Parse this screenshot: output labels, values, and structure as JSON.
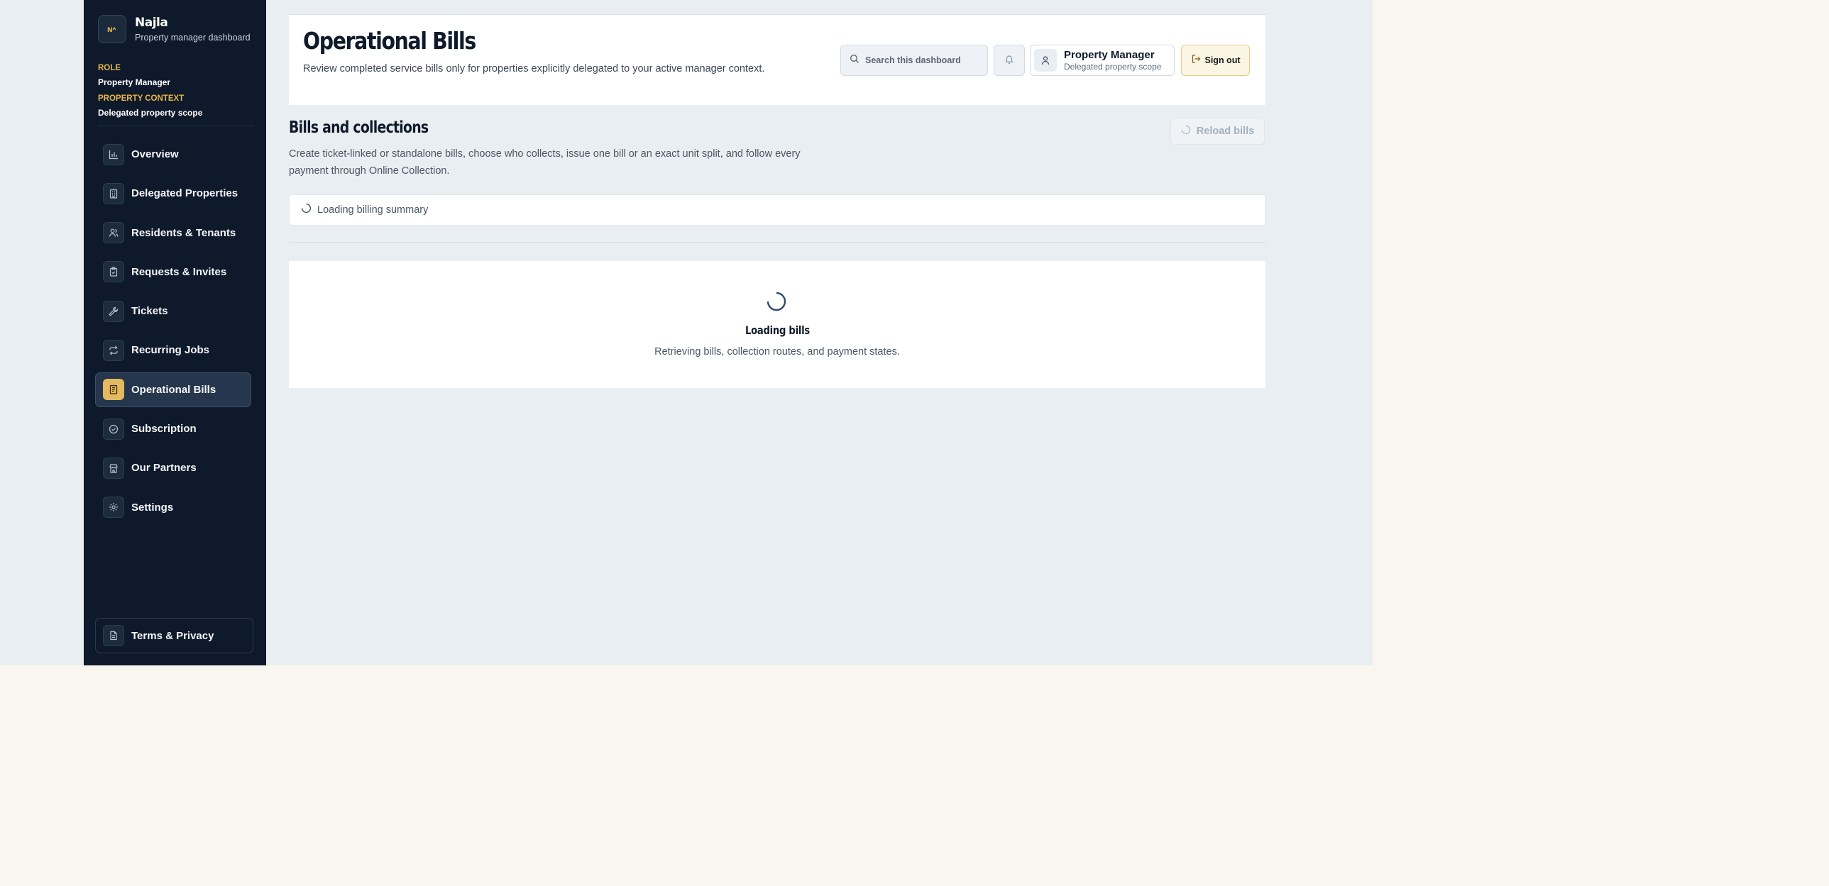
{
  "brand": {
    "logo_text": "Nਕ",
    "name": "Najla",
    "subtitle": "Property manager dashboard"
  },
  "meta": {
    "role_label": "ROLE",
    "role_value": "Property Manager",
    "context_label": "PROPERTY CONTEXT",
    "context_value": "Delegated property scope"
  },
  "nav": [
    {
      "label": "Overview",
      "icon": "bar-chart-icon"
    },
    {
      "label": "Delegated Properties",
      "icon": "building-icon"
    },
    {
      "label": "Residents & Tenants",
      "icon": "users-icon"
    },
    {
      "label": "Requests & Invites",
      "icon": "clipboard-icon"
    },
    {
      "label": "Tickets",
      "icon": "wrench-icon"
    },
    {
      "label": "Recurring Jobs",
      "icon": "repeat-icon"
    },
    {
      "label": "Operational Bills",
      "icon": "receipt-icon",
      "active": true
    },
    {
      "label": "Subscription",
      "icon": "check-circle-icon"
    },
    {
      "label": "Our Partners",
      "icon": "store-icon"
    },
    {
      "label": "Settings",
      "icon": "gear-icon"
    }
  ],
  "terms_label": "Terms & Privacy",
  "header": {
    "title": "Operational Bills",
    "description": "Review completed service bills only for properties explicitly delegated to your active manager context.",
    "search_placeholder": "Search this dashboard",
    "user_name": "Property Manager",
    "user_sub": "Delegated property scope",
    "signout_label": "Sign out"
  },
  "section": {
    "title": "Bills and collections",
    "description": "Create ticket-linked or standalone bills, choose who collects, issue one bill or an exact unit split, and follow every payment through Online Collection.",
    "reload_label": "Reload bills",
    "summary_loading": "Loading billing summary",
    "bills_loading_title": "Loading bills",
    "bills_loading_desc": "Retrieving bills, collection routes, and payment states."
  },
  "colors": {
    "sidebar_bg": "#0e1a2b",
    "accent": "#e4b95f",
    "content_bg": "#e9eef2",
    "page_bg": "#f9f6f0"
  }
}
